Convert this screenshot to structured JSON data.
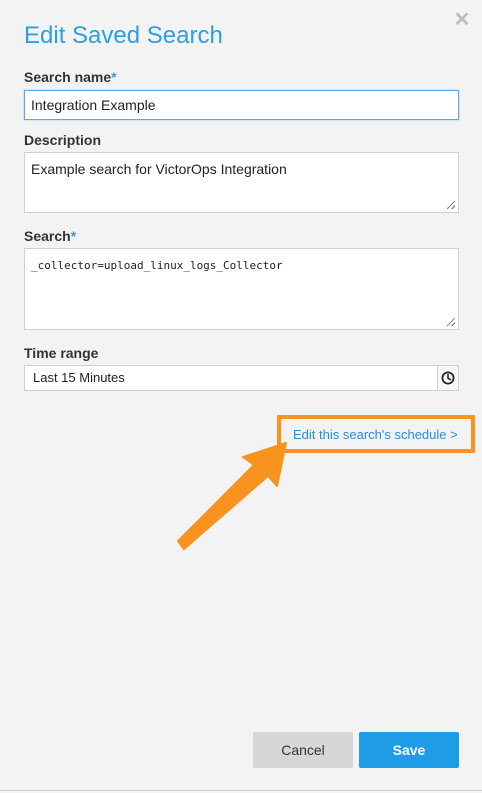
{
  "dialog": {
    "title": "Edit Saved Search",
    "close_glyph": "✕"
  },
  "form": {
    "search_name": {
      "label": "Search name",
      "required_mark": "*",
      "value": "Integration Example"
    },
    "description": {
      "label": "Description",
      "value": "Example search for VictorOps Integration"
    },
    "search": {
      "label": "Search",
      "required_mark": "*",
      "value": "_collector=upload_linux_logs_Collector"
    },
    "time_range": {
      "label": "Time range",
      "value": "Last 15 Minutes",
      "icon": "clock-icon"
    }
  },
  "schedule_link": {
    "label": "Edit this search's schedule >"
  },
  "annotation": {
    "highlight_color": "#f7931e"
  },
  "buttons": {
    "cancel_label": "Cancel",
    "save_label": "Save"
  },
  "colors": {
    "accent": "#2b9fe0",
    "save_button": "#1e9de6",
    "cancel_button": "#d6d6d6",
    "background": "#f3f3f3"
  }
}
